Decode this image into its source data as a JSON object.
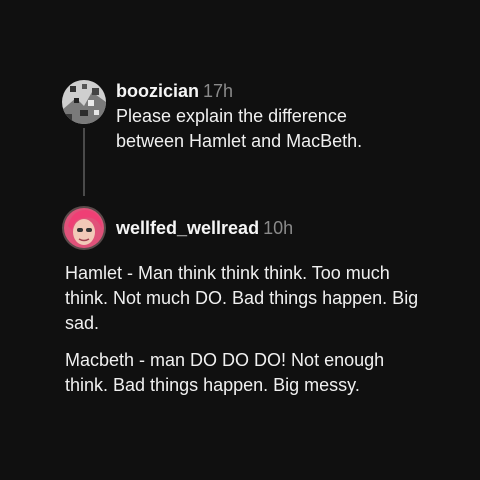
{
  "posts": [
    {
      "username": "boozician",
      "time": "17h",
      "text": "Please explain the difference between Hamlet and MacBeth.",
      "avatar_icon": "patterned-avatar"
    },
    {
      "username": "wellfed_wellread",
      "time": "10h",
      "paragraphs": [
        "Hamlet - Man think think think. Too much think. Not much DO. Bad things happen. Big sad.",
        "Macbeth - man DO DO DO! Not enough think. Bad things happen. Big messy."
      ],
      "avatar_icon": "pink-hair-avatar"
    }
  ],
  "colors": {
    "background": "#101010",
    "text": "#f3f3f3",
    "muted": "#8a8a8a",
    "thread_line": "#4a4a4a"
  }
}
